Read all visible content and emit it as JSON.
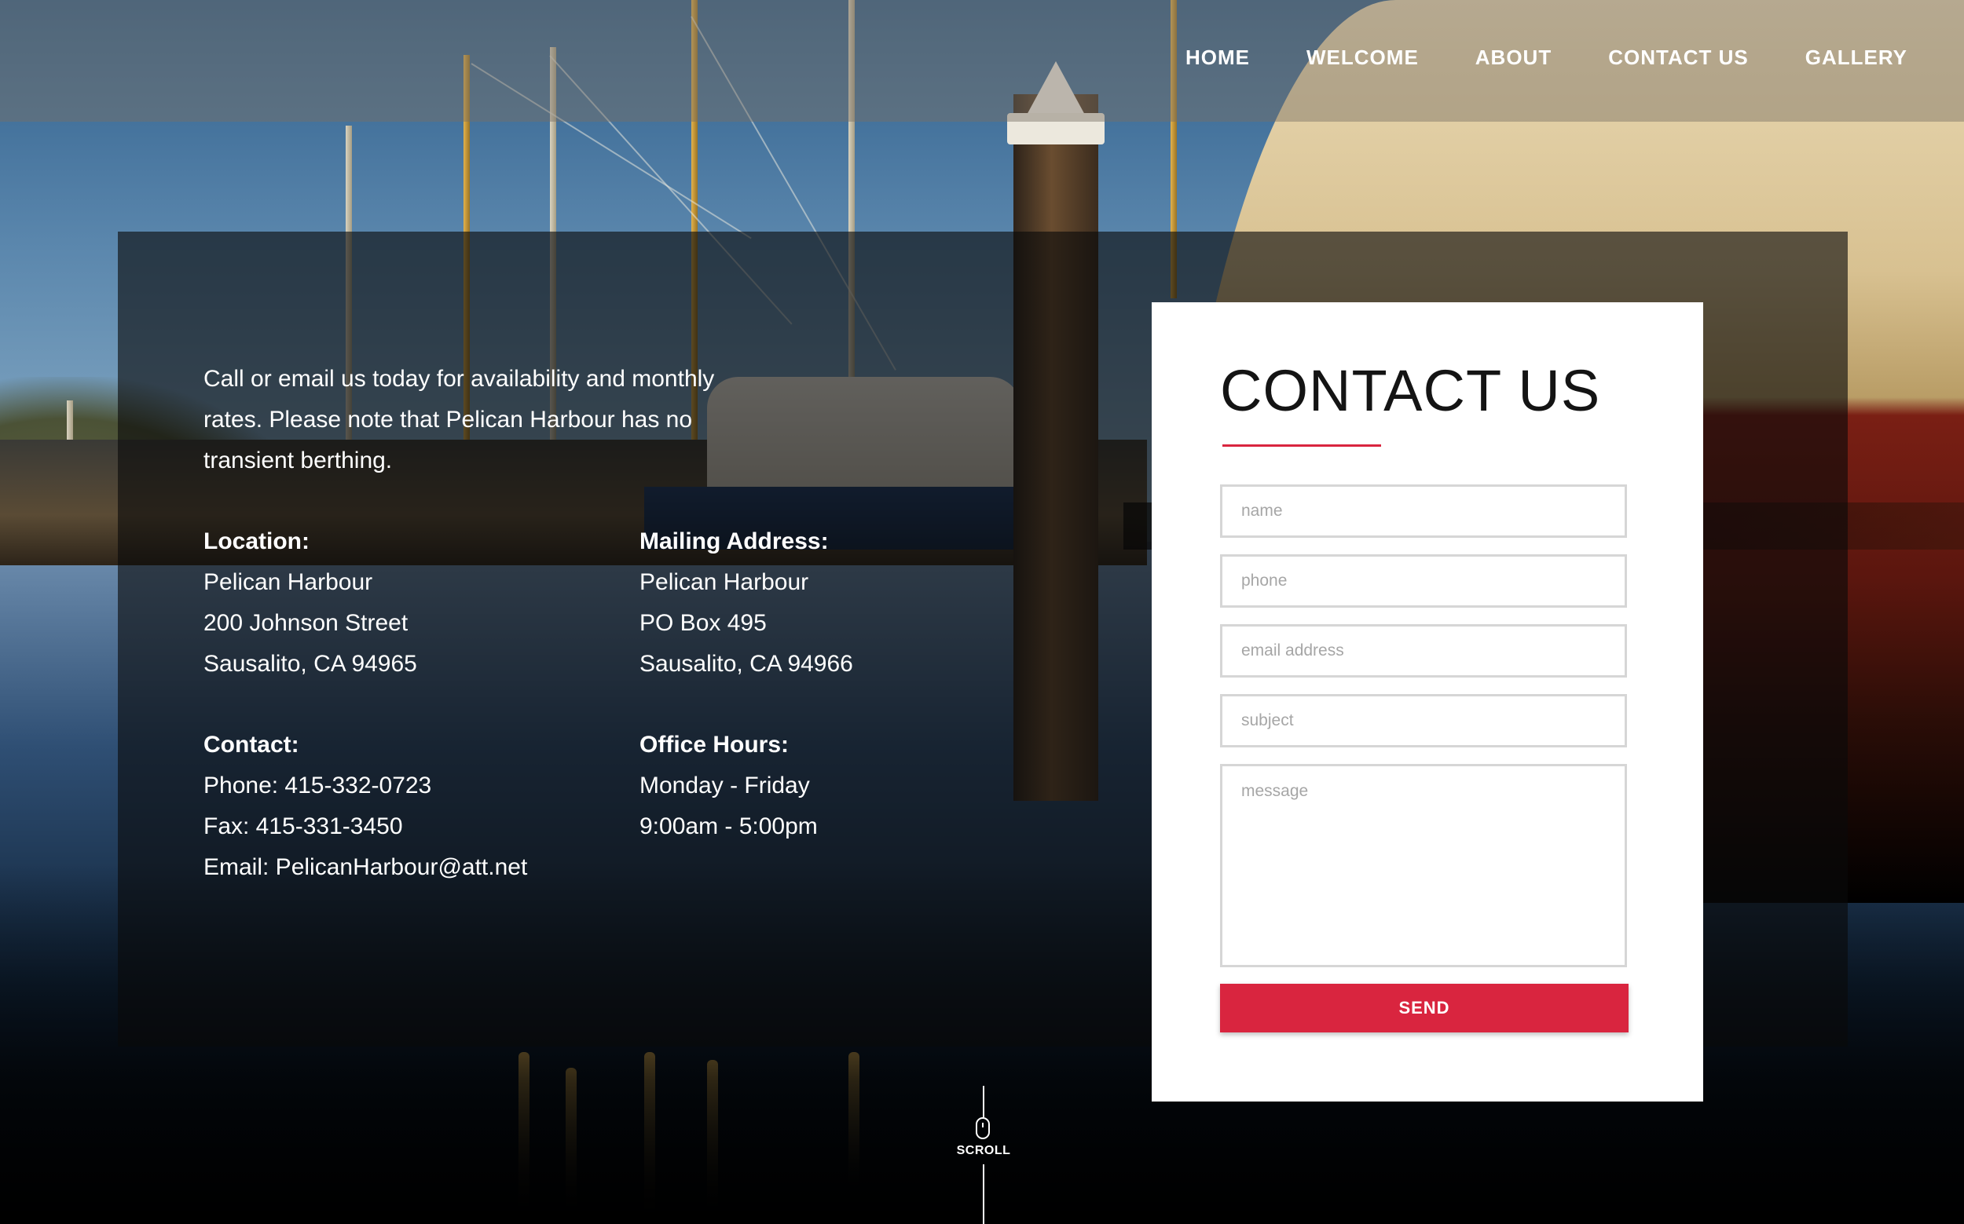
{
  "nav": {
    "items": [
      "HOME",
      "WELCOME",
      "ABOUT",
      "CONTACT US",
      "GALLERY"
    ]
  },
  "info": {
    "intro": "Call or email us today for availability and monthly rates.  Please note that Pelican Harbour has no transient berthing.",
    "location": {
      "heading": "Location:",
      "lines": [
        "Pelican Harbour",
        "200 Johnson Street",
        "Sausalito, CA 94965"
      ]
    },
    "mailing": {
      "heading": "Mailing Address:",
      "lines": [
        "Pelican Harbour",
        "PO Box 495",
        "Sausalito, CA 94966"
      ]
    },
    "contact": {
      "heading": "Contact:",
      "lines": [
        "Phone:  415-332-0723",
        "Fax:  415-331-3450",
        "Email:  PelicanHarbour@att.net"
      ]
    },
    "hours": {
      "heading": "Office Hours:",
      "lines": [
        "Monday - Friday",
        "9:00am - 5:00pm"
      ]
    }
  },
  "form": {
    "title": "CONTACT US",
    "accent_color": "#d9253f",
    "name_placeholder": "name",
    "phone_placeholder": "phone",
    "email_placeholder": "email address",
    "subject_placeholder": "subject",
    "message_placeholder": "message",
    "send_label": "SEND"
  },
  "scroll": {
    "label": "SCROLL",
    "icon": "mouse-icon"
  }
}
